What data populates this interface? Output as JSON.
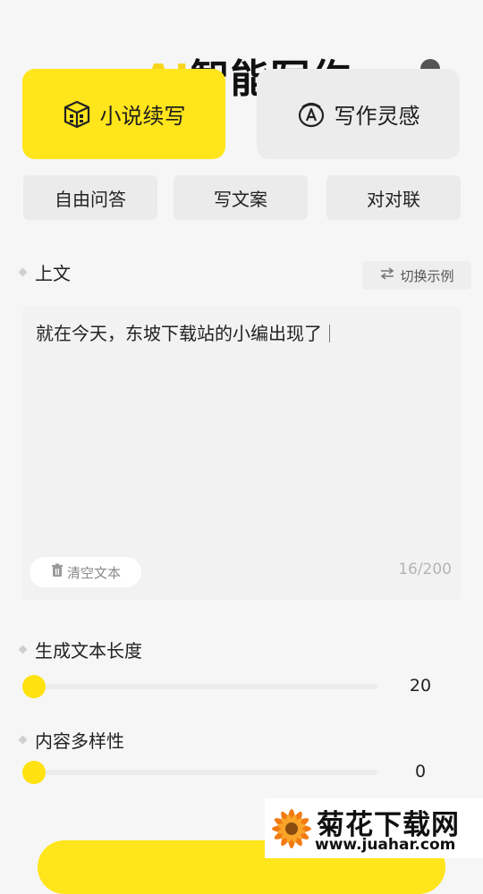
{
  "header": {
    "title_prefix": "AI",
    "title": "智能写作"
  },
  "modes": [
    {
      "label": "小说续写",
      "icon": "cube-icon",
      "active": true
    },
    {
      "label": "写作灵感",
      "icon": "a-badge-icon",
      "active": false
    }
  ],
  "tabs": [
    {
      "label": "自由问答"
    },
    {
      "label": "写文案"
    },
    {
      "label": "对对联"
    }
  ],
  "context_section": {
    "label": "上文",
    "switch_example_label": "切换示例",
    "text": "就在今天，东坡下载站的小编出现了",
    "clear_label": "清空文本",
    "char_count": "16/200"
  },
  "length_section": {
    "label": "生成文本长度",
    "value": "20",
    "slider_fraction": 0
  },
  "diversity_section": {
    "label": "内容多样性",
    "value": "0",
    "slider_fraction": 0
  },
  "watermark": {
    "title": "菊花下载网",
    "url": "www.juahar.com"
  },
  "colors": {
    "accent": "#ffe51c",
    "background": "#f6f6f6",
    "card_inactive": "#ececec"
  }
}
